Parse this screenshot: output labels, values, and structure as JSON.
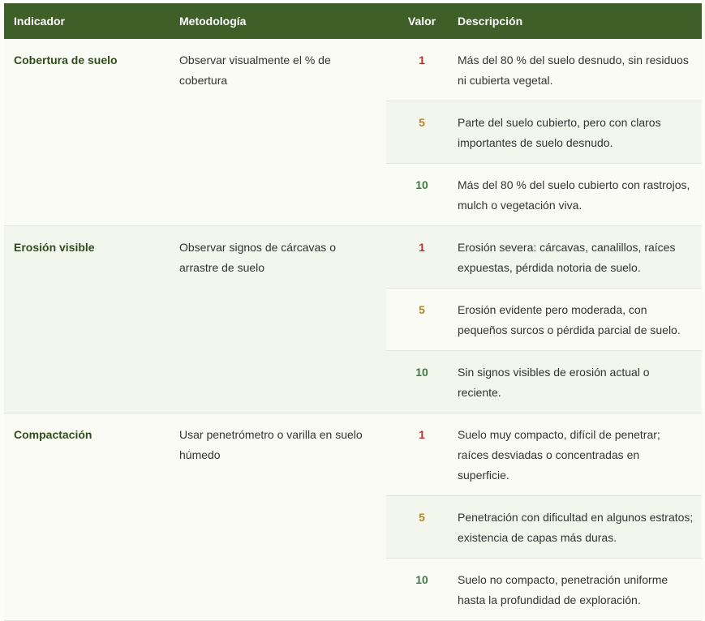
{
  "header": {
    "indicator": "Indicador",
    "methodology": "Metodología",
    "value": "Valor",
    "description": "Descripción"
  },
  "colors": {
    "header_bg": "#3e5f28",
    "value_low": "#b3352b",
    "value_mid": "#b8862b",
    "value_high": "#3e7a45"
  },
  "rows": [
    {
      "indicator": "Cobertura de suelo",
      "methodology": "Observar visualmente el % de cobertura",
      "levels": [
        {
          "value": "1",
          "description": "Más del 80 % del suelo desnudo, sin residuos ni cubierta vegetal."
        },
        {
          "value": "5",
          "description": "Parte del suelo cubierto, pero con claros importantes de suelo desnudo."
        },
        {
          "value": "10",
          "description": "Más del 80 % del suelo cubierto con rastrojos, mulch o vegetación viva."
        }
      ]
    },
    {
      "indicator": "Erosión visible",
      "methodology": "Observar signos de cárcavas o arrastre de suelo",
      "levels": [
        {
          "value": "1",
          "description": "Erosión severa: cárcavas, canalillos, raíces expuestas, pérdida notoria de suelo."
        },
        {
          "value": "5",
          "description": "Erosión evidente pero moderada, con pequeños surcos o pérdida parcial de suelo."
        },
        {
          "value": "10",
          "description": "Sin signos visibles de erosión actual o reciente."
        }
      ]
    },
    {
      "indicator": "Compactación",
      "methodology": "Usar penetrómetro o varilla en suelo húmedo",
      "levels": [
        {
          "value": "1",
          "description": "Suelo muy compacto, difícil de penetrar; raíces desviadas o concentradas en superficie."
        },
        {
          "value": "5",
          "description": "Penetración con dificultad en algunos estratos; existencia de capas más duras."
        },
        {
          "value": "10",
          "description": "Suelo no compacto, penetración uniforme hasta la profundidad de exploración."
        }
      ]
    }
  ]
}
